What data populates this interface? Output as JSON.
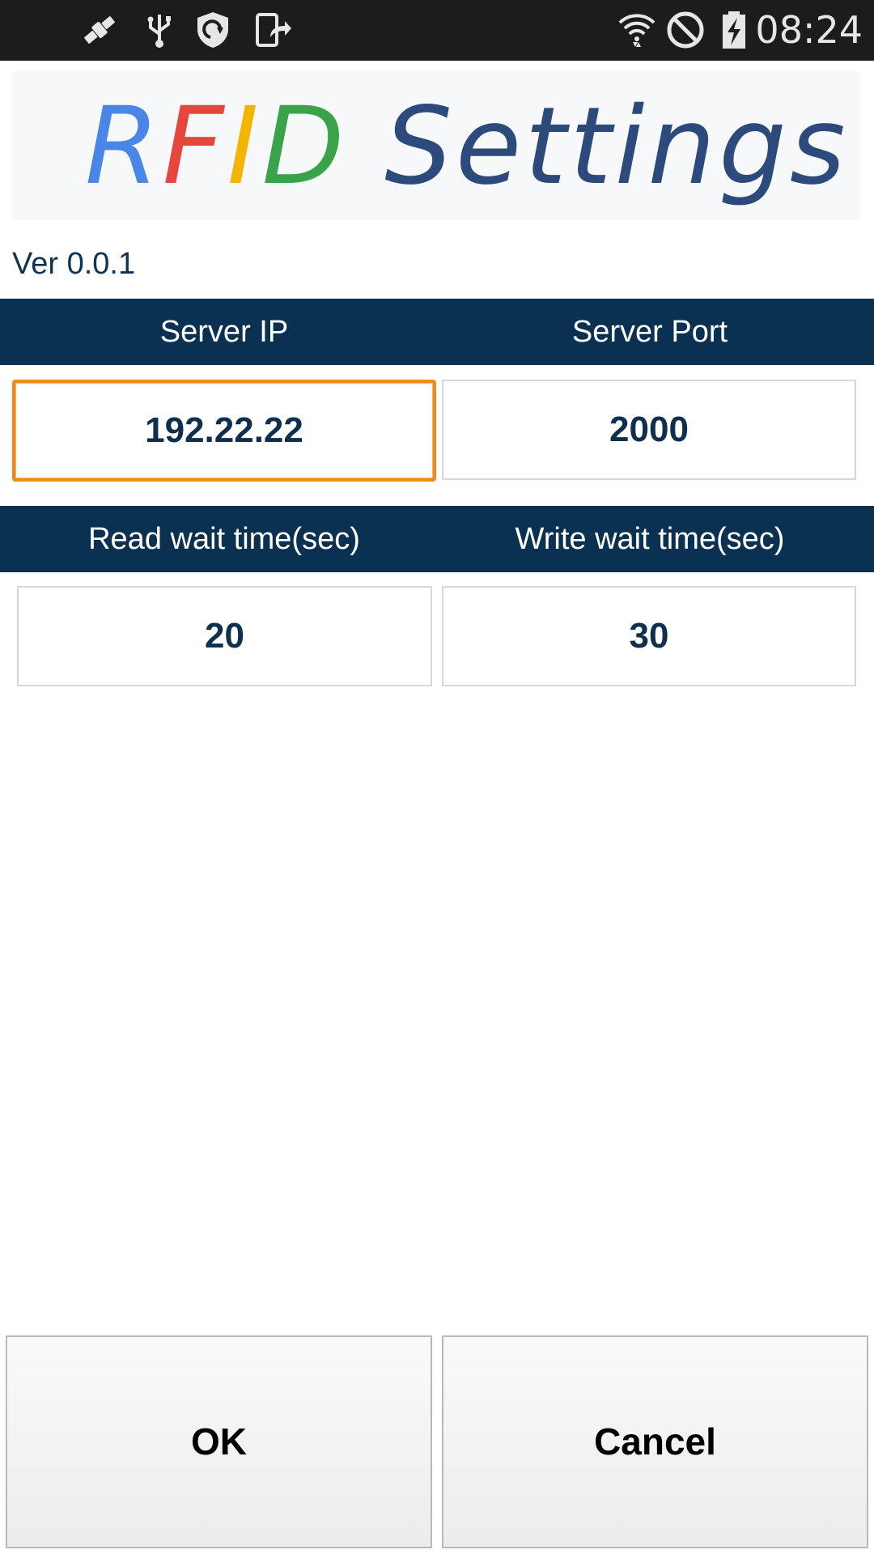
{
  "status_bar": {
    "time": "08:24",
    "left_icons": [
      "satellite-icon",
      "usb-icon",
      "shield-update-icon",
      "device-export-icon"
    ],
    "right_icons": [
      "wifi-icon",
      "do-not-disturb-icon",
      "battery-charging-icon"
    ]
  },
  "banner": {
    "rfid_letters": [
      "R",
      "F",
      "I",
      "D"
    ],
    "rest": "Settings",
    "colors": {
      "R": "#4a86e8",
      "F": "#e8453c",
      "I": "#f4b400",
      "D": "#3aa34a",
      "rest": "#2d4a7d"
    }
  },
  "version": "Ver 0.0.1",
  "server": {
    "ip_label": "Server IP",
    "port_label": "Server Port",
    "ip_value": "192.22.22",
    "port_value": "2000"
  },
  "wait": {
    "read_label": "Read wait time(sec)",
    "write_label": "Write wait time(sec)",
    "read_value": "20",
    "write_value": "30"
  },
  "buttons": {
    "ok": "OK",
    "cancel": "Cancel"
  },
  "colors": {
    "header_bg": "#0b3152",
    "focus_border": "#f08a1c",
    "value_text": "#0f2f4f"
  }
}
